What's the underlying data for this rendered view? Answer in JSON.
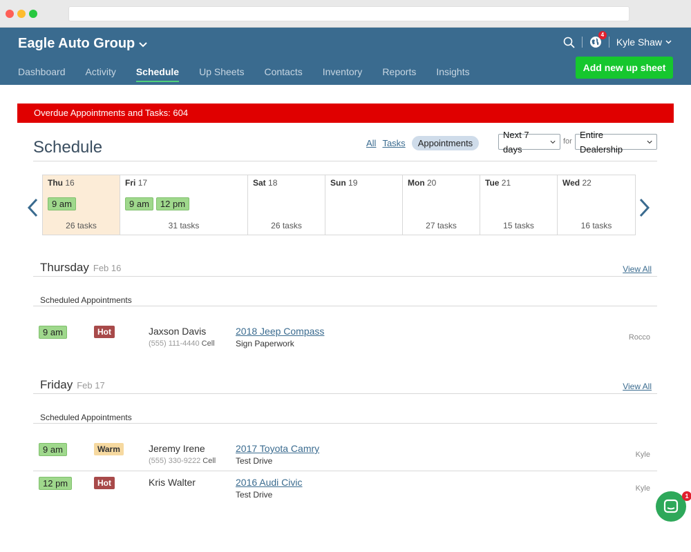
{
  "header": {
    "brand": "Eagle Auto Group",
    "user_name": "Kyle Shaw",
    "notification_count": "4",
    "add_button_label": "Add new up sheet",
    "nav": [
      "Dashboard",
      "Activity",
      "Schedule",
      "Up Sheets",
      "Contacts",
      "Inventory",
      "Reports",
      "Insights"
    ],
    "active_nav": "Schedule"
  },
  "overdue_banner": "Overdue Appointments and Tasks: 604",
  "schedule": {
    "title": "Schedule",
    "filters": {
      "all": "All",
      "tasks": "Tasks",
      "appointments": "Appointments"
    },
    "range_select": "Next 7 days",
    "for_label": "for",
    "scope_select": "Entire Dealership"
  },
  "calendar": [
    {
      "dow": "Thu",
      "day": "16",
      "chips": [
        "9 am"
      ],
      "count": "26 tasks",
      "today": true
    },
    {
      "dow": "Fri",
      "day": "17",
      "chips": [
        "9 am",
        "12 pm"
      ],
      "count": "31 tasks"
    },
    {
      "dow": "Sat",
      "day": "18",
      "chips": [],
      "count": "26 tasks"
    },
    {
      "dow": "Sun",
      "day": "19",
      "chips": [],
      "count": ""
    },
    {
      "dow": "Mon",
      "day": "20",
      "chips": [],
      "count": "27 tasks"
    },
    {
      "dow": "Tue",
      "day": "21",
      "chips": [],
      "count": "15 tasks"
    },
    {
      "dow": "Wed",
      "day": "22",
      "chips": [],
      "count": "16 tasks"
    }
  ],
  "sections": [
    {
      "day": "Thursday",
      "date": "Feb 16",
      "view_all": "View All",
      "sub_heading": "Scheduled Appointments",
      "appointments": [
        {
          "time": "9 am",
          "temperature": "Hot",
          "name": "Jaxson Davis",
          "phone": "(555) 111-4440",
          "phone_type": "Cell",
          "vehicle": "2018 Jeep Compass",
          "task": "Sign Paperwork",
          "owner": "Rocco"
        }
      ]
    },
    {
      "day": "Friday",
      "date": "Feb 17",
      "view_all": "View All",
      "sub_heading": "Scheduled Appointments",
      "appointments": [
        {
          "time": "9 am",
          "temperature": "Warm",
          "name": "Jeremy Irene",
          "phone": "(555) 330-9222",
          "phone_type": "Cell",
          "vehicle": "2017 Toyota Camry",
          "task": "Test Drive",
          "owner": "Kyle"
        },
        {
          "time": "12 pm",
          "temperature": "Hot",
          "name": "Kris Walter",
          "phone": "",
          "phone_type": "",
          "vehicle": "2016 Audi Civic",
          "task": "Test Drive",
          "owner": "Kyle"
        }
      ]
    }
  ],
  "chat_badge": "1",
  "colors": {
    "header_bg": "#3a6b8f",
    "add_button": "#16c72e",
    "overdue_banner": "#e00000",
    "time_chip": "#9fd88c",
    "hot": "#a84a4a",
    "warm": "#f6d9a0",
    "today_bg": "#fcecd7",
    "chat": "#2ea85a"
  }
}
